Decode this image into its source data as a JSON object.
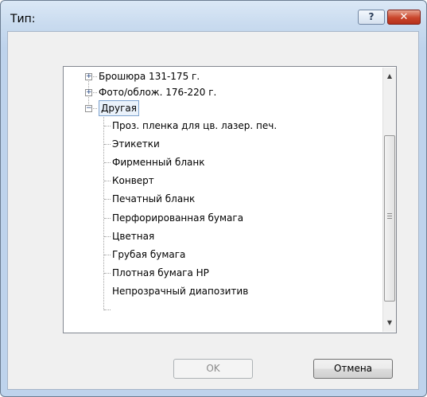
{
  "window": {
    "title": "Тип:",
    "help_label": "?",
    "close_label": "✕"
  },
  "tree": {
    "items": [
      {
        "label": "Брошюра 131-175 г.",
        "level": 0,
        "expander": "+"
      },
      {
        "label": "Фото/облож. 176-220 г.",
        "level": 0,
        "expander": "+"
      },
      {
        "label": "Другая",
        "level": 0,
        "expander": "−",
        "selected": true
      },
      {
        "label": "Проз. пленка для цв. лазер. печ.",
        "level": 1
      },
      {
        "label": "Этикетки",
        "level": 1
      },
      {
        "label": "Фирменный бланк",
        "level": 1
      },
      {
        "label": "Конверт",
        "level": 1
      },
      {
        "label": "Печатный бланк",
        "level": 1
      },
      {
        "label": "Перфорированная бумага",
        "level": 1
      },
      {
        "label": "Цветная",
        "level": 1
      },
      {
        "label": "Грубая бумага",
        "level": 1
      },
      {
        "label": "Плотная бумага HP",
        "level": 1
      },
      {
        "label": "Непрозрачный диапозитив",
        "level": 1
      }
    ]
  },
  "scrollbar": {
    "up_arrow": "▲",
    "down_arrow": "▼"
  },
  "buttons": {
    "ok_label": "OK",
    "cancel_label": "Отмена"
  }
}
